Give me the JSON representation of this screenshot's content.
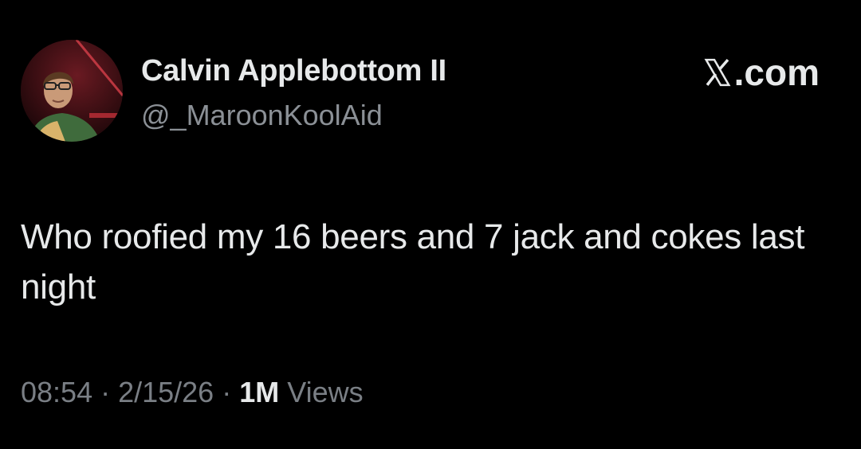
{
  "author": {
    "display_name": "Calvin Applebottom II",
    "handle": "@_MaroonKoolAid",
    "avatar": "profile-photo"
  },
  "brand": {
    "icon": "x-logo-icon",
    "suffix": ".com"
  },
  "tweet": {
    "text": "Who roofied my 16 beers and 7 jack and cokes last night"
  },
  "meta": {
    "time": "08:54",
    "separator": "·",
    "date": "2/15/26",
    "views_count": "1M",
    "views_label": "Views"
  },
  "colors": {
    "background": "#000000",
    "primary_text": "#e7e9ea",
    "secondary_text": "#7a7f85"
  }
}
